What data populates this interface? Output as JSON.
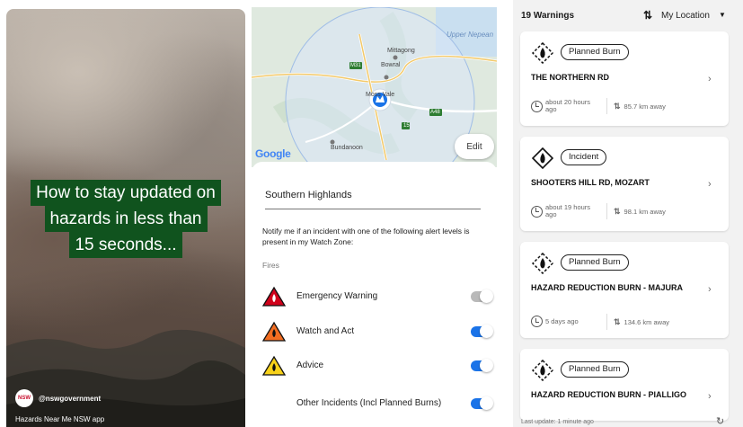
{
  "video": {
    "headline": [
      "How to stay updated on",
      "hazards in less than",
      "15 seconds..."
    ],
    "avatar_text": "NSW",
    "author": "@nswgovernment",
    "app_name": "Hazards Near Me NSW app",
    "colors": {
      "headline_bg": "#10531e"
    }
  },
  "map": {
    "labels": {
      "upper_nepean": "Upper Nepean",
      "mittagong": "Mittagong",
      "bowral": "Bowral",
      "moss_vale": "Moss Vale",
      "bundanoon": "Bundanoon",
      "m31": "M31",
      "a48": "A48",
      "r15": "15"
    },
    "google_logo": "Google",
    "edit_label": "Edit"
  },
  "watch_zone": {
    "name": "Southern Highlands",
    "notify_text": "Notify me if an incident with one of the following alert levels is present in my Watch Zone:",
    "section_label": "Fires",
    "alerts": [
      {
        "label": "Emergency Warning",
        "enabled": false,
        "icon": "emergency-warning-triangle-icon",
        "color": "#d0021b"
      },
      {
        "label": "Watch and Act",
        "enabled": true,
        "icon": "watch-and-act-triangle-icon",
        "color": "#f26d21"
      },
      {
        "label": "Advice",
        "enabled": true,
        "icon": "advice-triangle-icon",
        "color": "#f8d21a"
      },
      {
        "label": "Other Incidents (Incl Planned Burns)",
        "enabled": true,
        "icon": "other-incidents-icon",
        "color": "#1a73e8"
      }
    ]
  },
  "warnings": {
    "count_label": "19 Warnings",
    "location_label": "My Location",
    "items": [
      {
        "type": "Planned Burn",
        "title": "THE NORTHERN RD",
        "time": "about 20 hours ago",
        "distance": "85.7 km away"
      },
      {
        "type": "Incident",
        "title": "SHOOTERS HILL RD, MOZART",
        "time": "about 19 hours ago",
        "distance": "98.1 km away"
      },
      {
        "type": "Planned Burn",
        "title": "HAZARD REDUCTION BURN - MAJURA",
        "time": "5 days ago",
        "distance": "134.6 km away"
      },
      {
        "type": "Planned Burn",
        "title": "HAZARD REDUCTION BURN - PIALLIGO",
        "time": "",
        "distance": ""
      }
    ],
    "footer": "Last update: 1 minute ago"
  }
}
